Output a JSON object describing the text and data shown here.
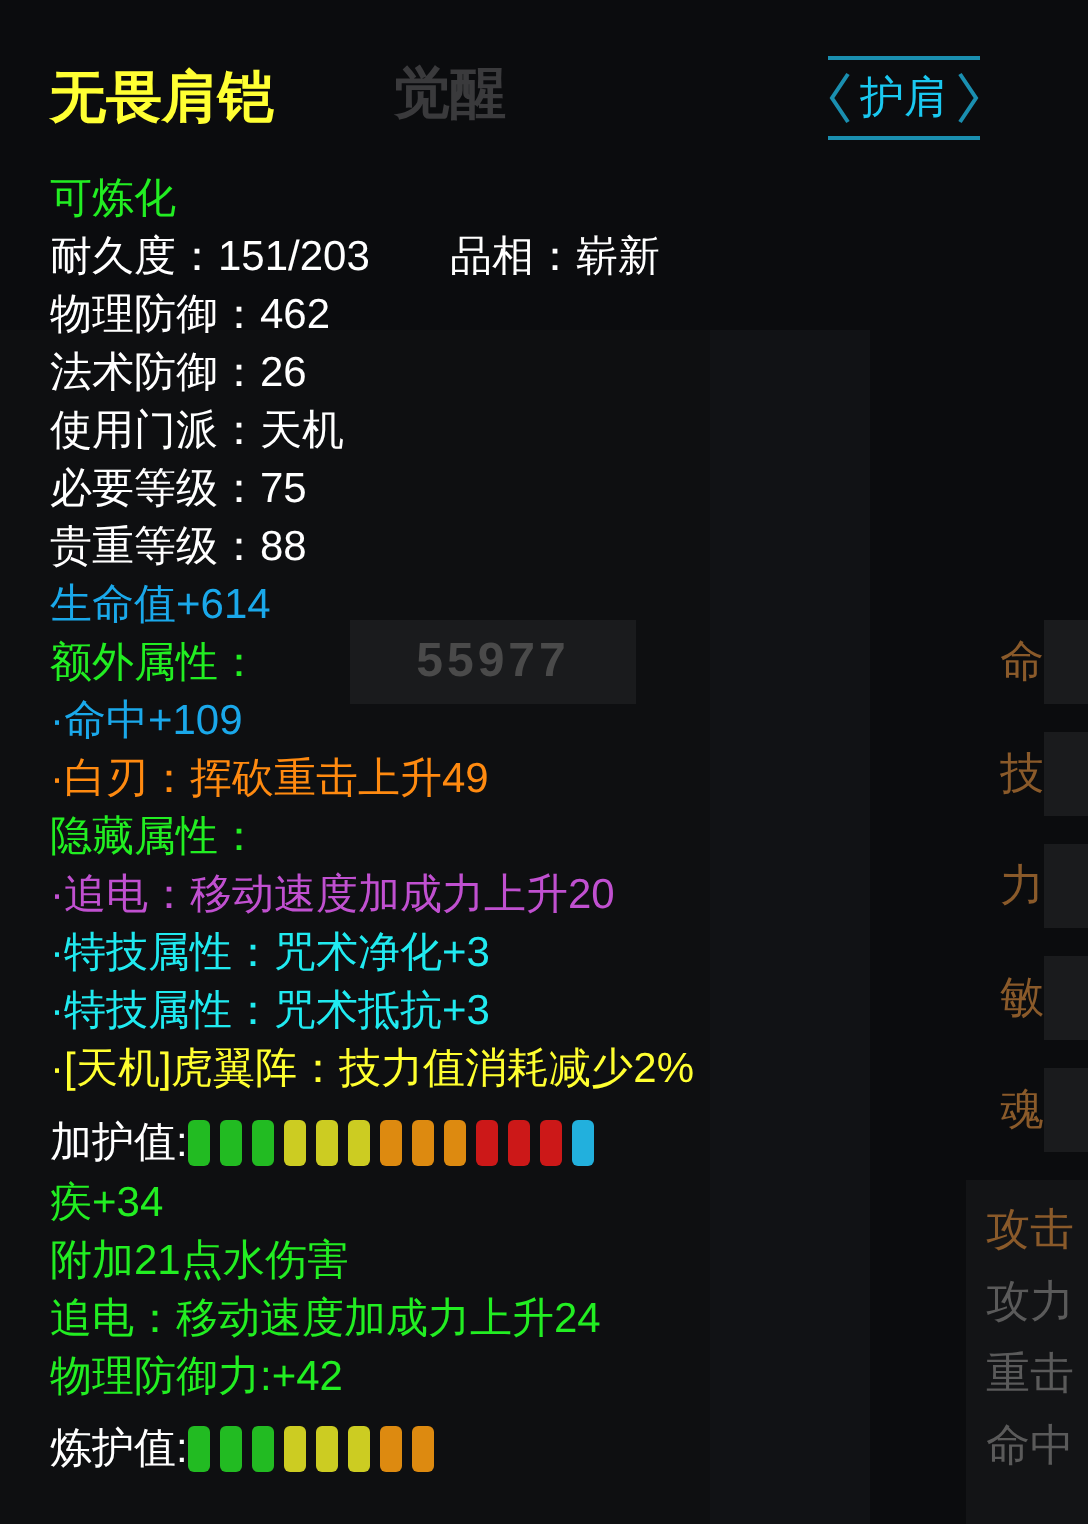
{
  "background": {
    "tabs": [
      {
        "label": "觉醒",
        "selected": false
      }
    ],
    "score_field": {
      "value": "55977"
    },
    "stats": [
      {
        "label": "命"
      },
      {
        "label": "技"
      },
      {
        "label": "力"
      },
      {
        "label": "敏"
      },
      {
        "label": "魂"
      }
    ],
    "attack_panel": {
      "title": "攻击",
      "rows": [
        "攻力",
        "重击",
        "命中"
      ]
    }
  },
  "tooltip": {
    "title": "无畏肩铠",
    "slot": "护肩",
    "lines": [
      {
        "kind": "text",
        "color": "#22ee22",
        "texts": [
          "可炼化"
        ]
      },
      {
        "kind": "text",
        "color": "#ffffff",
        "texts": [
          "耐久度：151/203",
          "品相：崭新"
        ]
      },
      {
        "kind": "text",
        "color": "#ffffff",
        "texts": [
          "物理防御：462"
        ]
      },
      {
        "kind": "text",
        "color": "#ffffff",
        "texts": [
          "法术防御：26"
        ]
      },
      {
        "kind": "text",
        "color": "#ffffff",
        "texts": [
          "使用门派：天机"
        ]
      },
      {
        "kind": "text",
        "color": "#ffffff",
        "texts": [
          "必要等级：75"
        ]
      },
      {
        "kind": "text",
        "color": "#ffffff",
        "texts": [
          "贵重等级：88"
        ]
      },
      {
        "kind": "text",
        "color": "#1aa8ea",
        "texts": [
          "生命值+614"
        ]
      },
      {
        "kind": "text",
        "color": "#22ee22",
        "texts": [
          "额外属性："
        ]
      },
      {
        "kind": "text",
        "color": "#1aa8ea",
        "texts": [
          "·命中+109"
        ]
      },
      {
        "kind": "text",
        "color": "#ff8a10",
        "texts": [
          "·白刃：挥砍重击上升49"
        ]
      },
      {
        "kind": "text",
        "color": "#22ee22",
        "texts": [
          "隐藏属性："
        ]
      },
      {
        "kind": "text",
        "color": "#c050d0",
        "texts": [
          "·追电：移动速度加成力上升20"
        ]
      },
      {
        "kind": "text",
        "color": "#20eaf0",
        "texts": [
          "·特技属性：咒术净化+3"
        ]
      },
      {
        "kind": "text",
        "color": "#20eaf0",
        "texts": [
          "·特技属性：咒术抵抗+3"
        ]
      },
      {
        "kind": "text",
        "color": "#ffff30",
        "texts": [
          "·[天机]虎翼阵：技力值消耗减少2%"
        ]
      },
      {
        "kind": "meter",
        "label": "加护值:",
        "segments": [
          {
            "color": "#22bb22"
          },
          {
            "color": "#22bb22"
          },
          {
            "color": "#22bb22"
          },
          {
            "color": "#cccc22"
          },
          {
            "color": "#cccc22"
          },
          {
            "color": "#cccc22"
          },
          {
            "color": "#dd8a10"
          },
          {
            "color": "#dd8a10"
          },
          {
            "color": "#dd8a10"
          },
          {
            "color": "#cc1818"
          },
          {
            "color": "#cc1818"
          },
          {
            "color": "#cc1818"
          },
          {
            "color": "#22b0dd"
          }
        ]
      },
      {
        "kind": "text",
        "color": "#22ee22",
        "texts": [
          "疾+34"
        ]
      },
      {
        "kind": "text",
        "color": "#22ee22",
        "texts": [
          "附加21点水伤害"
        ]
      },
      {
        "kind": "text",
        "color": "#22ee22",
        "texts": [
          "追电：移动速度加成力上升24"
        ]
      },
      {
        "kind": "text",
        "color": "#22ee22",
        "texts": [
          "物理防御力:+42"
        ]
      },
      {
        "kind": "meter",
        "label": "炼护值:",
        "segments": [
          {
            "color": "#22bb22"
          },
          {
            "color": "#22bb22"
          },
          {
            "color": "#22bb22"
          },
          {
            "color": "#cccc22"
          },
          {
            "color": "#cccc22"
          },
          {
            "color": "#cccc22"
          },
          {
            "color": "#dd8a10"
          },
          {
            "color": "#dd8a10"
          }
        ]
      }
    ]
  }
}
